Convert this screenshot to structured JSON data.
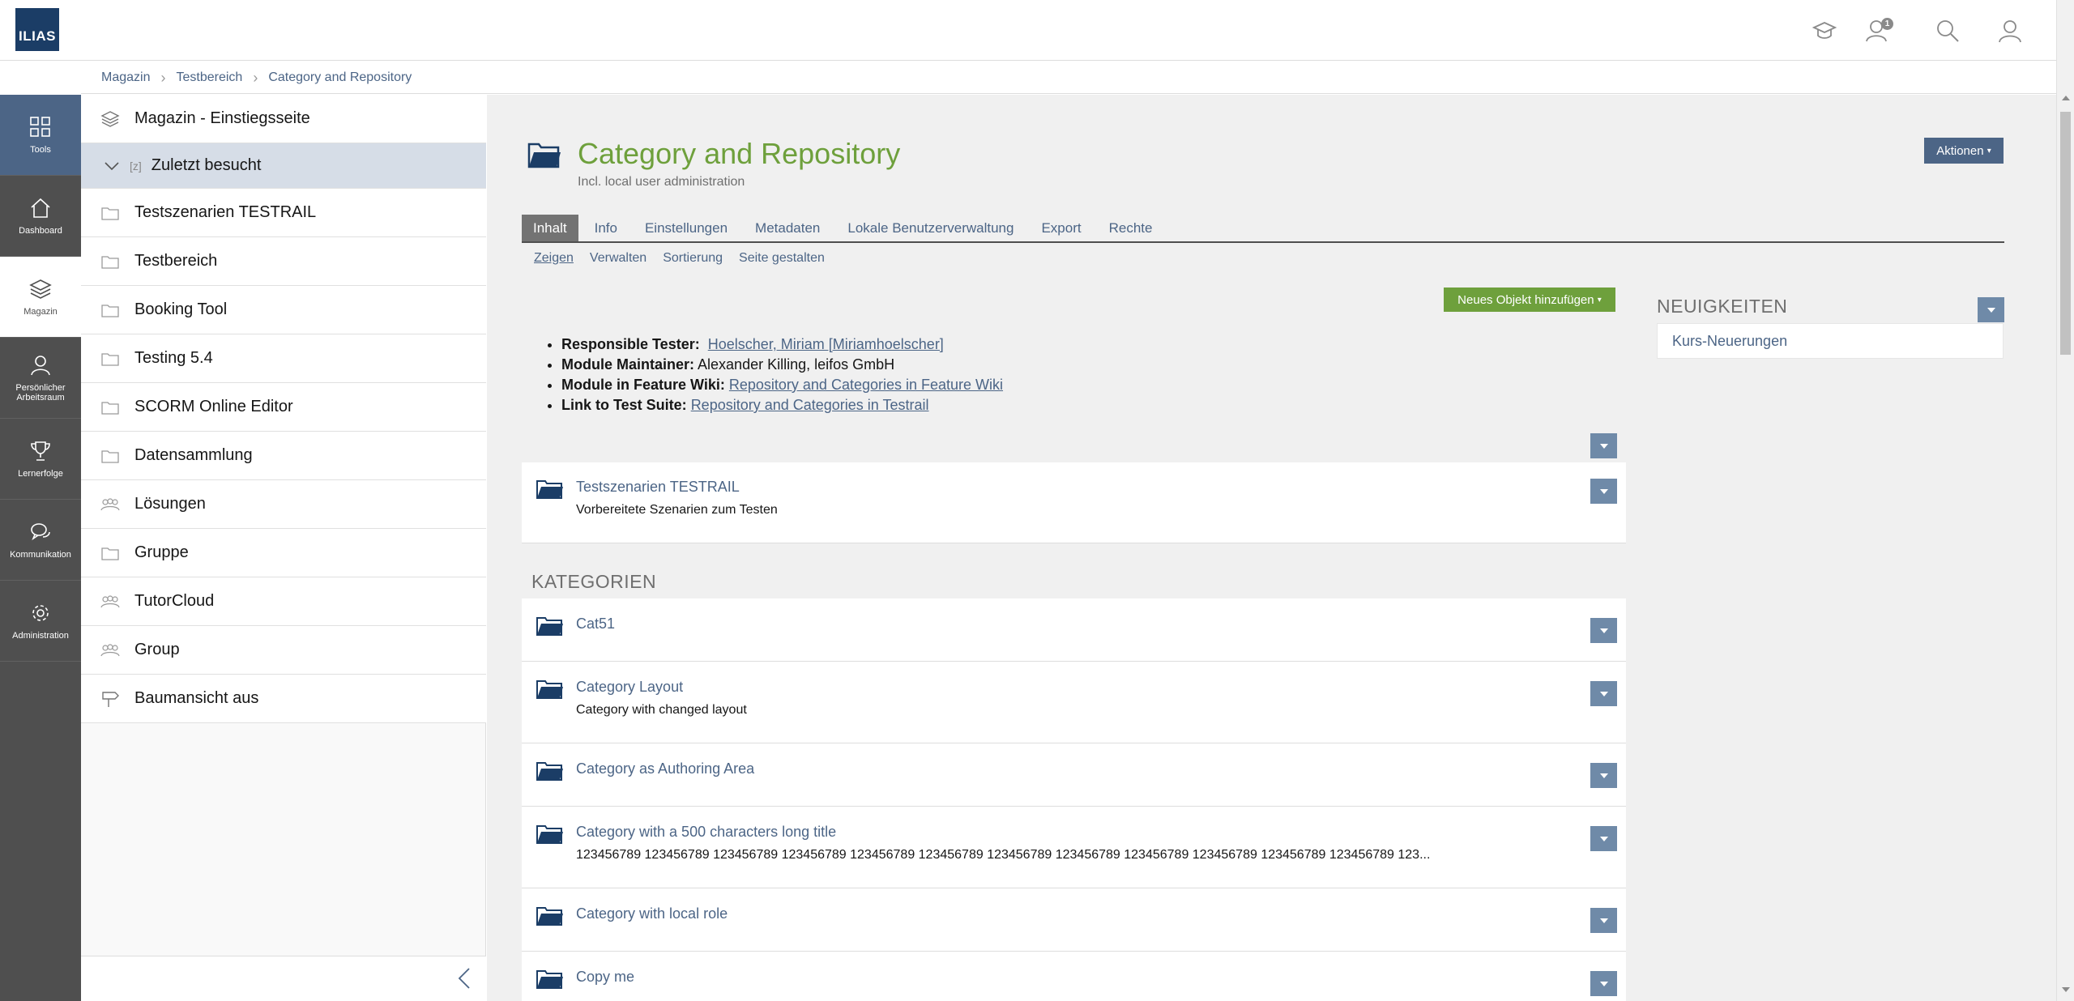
{
  "logo": "ILIAS",
  "header": {
    "notification_count": "1"
  },
  "breadcrumbs": [
    "Magazin",
    "Testbereich",
    "Category and Repository"
  ],
  "mainbar": [
    {
      "label": "Tools",
      "icon": "grid-icon"
    },
    {
      "label": "Dashboard",
      "icon": "home-icon"
    },
    {
      "label": "Magazin",
      "icon": "layers-icon"
    },
    {
      "label": "Persönlicher Arbeitsraum",
      "icon": "user-icon"
    },
    {
      "label": "Lernerfolge",
      "icon": "trophy-icon"
    },
    {
      "label": "Kommunikation",
      "icon": "chat-icon"
    },
    {
      "label": "Administration",
      "icon": "gear-icon"
    }
  ],
  "slate": [
    {
      "label": "Magazin - Einstiegsseite",
      "icon": "layers-icon"
    },
    {
      "label": "Zuletzt besucht",
      "icon": "chevron-down-icon"
    },
    {
      "label": "Testszenarien TESTRAIL",
      "icon": "folder-icon"
    },
    {
      "label": "Testbereich",
      "icon": "folder-icon"
    },
    {
      "label": "Booking Tool",
      "icon": "folder-icon"
    },
    {
      "label": "Testing 5.4",
      "icon": "folder-icon"
    },
    {
      "label": "SCORM Online Editor",
      "icon": "folder-icon"
    },
    {
      "label": "Datensammlung",
      "icon": "folder-icon"
    },
    {
      "label": "Lösungen",
      "icon": "group-icon"
    },
    {
      "label": "Gruppe",
      "icon": "folder-icon"
    },
    {
      "label": "TutorCloud",
      "icon": "group-icon"
    },
    {
      "label": "Group",
      "icon": "group-icon"
    },
    {
      "label": "Baumansicht aus",
      "icon": "signpost-icon"
    }
  ],
  "page": {
    "title": "Category and Repository",
    "description": "Incl. local user administration",
    "actions_label": "Aktionen",
    "add_object_label": "Neues Objekt hinzufügen"
  },
  "tabs": [
    "Inhalt",
    "Info",
    "Einstellungen",
    "Metadaten",
    "Lokale Benutzerverwaltung",
    "Export",
    "Rechte"
  ],
  "subtabs": [
    "Zeigen",
    "Verwalten",
    "Sortierung",
    "Seite gestalten"
  ],
  "info": [
    {
      "label": "Responsible Tester:",
      "text": "",
      "link": "Hoelscher, Miriam [Miriamhoelscher]"
    },
    {
      "label": "Module Maintainer:",
      "text": "Alexander Killing, leifos GmbH",
      "link": ""
    },
    {
      "label": "Module in Feature Wiki:",
      "text": "",
      "link": "Repository and Categories in Feature Wiki"
    },
    {
      "label": "Link to Test Suite:",
      "text": "",
      "link": "Repository and Categories in Testrail"
    }
  ],
  "first_item": {
    "title": "Testszenarien TESTRAIL",
    "desc": "Vorbereitete Szenarien zum Testen"
  },
  "section_heading": "KATEGORIEN",
  "categories": [
    {
      "title": "Cat51",
      "desc": ""
    },
    {
      "title": "Category Layout",
      "desc": "Category with changed layout"
    },
    {
      "title": "Category as Authoring Area",
      "desc": ""
    },
    {
      "title": "Category with a 500 characters long title",
      "desc": "123456789 123456789 123456789 123456789 123456789 123456789 123456789 123456789 123456789 123456789 123456789 123456789 123..."
    },
    {
      "title": "Category with local role",
      "desc": ""
    },
    {
      "title": "Copy me",
      "desc": ""
    }
  ],
  "news": {
    "heading": "NEUIGKEITEN",
    "link": "Kurs-Neuerungen"
  },
  "colors": {
    "accent": "#4c6586",
    "title_green": "#6ea03c",
    "mainbar": "#4f4f4f"
  }
}
